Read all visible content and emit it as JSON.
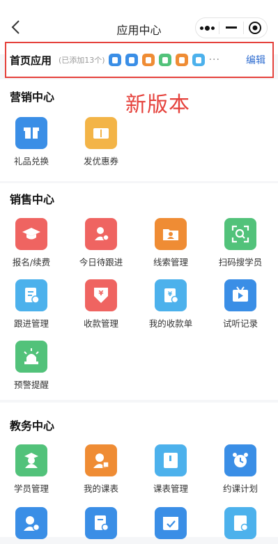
{
  "nav": {
    "title": "应用中心"
  },
  "home_apps": {
    "title": "首页应用",
    "added": "(已添加13个)",
    "more": "···",
    "edit": "编辑",
    "mini_icons": [
      {
        "icon": "student-icon",
        "color": "#3a8ee6"
      },
      {
        "icon": "doc-icon",
        "color": "#3a8ee6"
      },
      {
        "icon": "folder-icon",
        "color": "#ef8c34"
      },
      {
        "icon": "trophy-icon",
        "color": "#52c27a"
      },
      {
        "icon": "person-icon",
        "color": "#ef8c34"
      },
      {
        "icon": "book-icon",
        "color": "#4cb1ec"
      }
    ]
  },
  "annotation": "新版本",
  "marketing": {
    "title": "营销中心",
    "apps": [
      {
        "label": "礼品兑换",
        "icon": "gift-icon",
        "color": "#3a8ee6"
      },
      {
        "label": "发优惠券",
        "icon": "coupon-icon",
        "color": "#f3b447"
      }
    ]
  },
  "sales": {
    "title": "销售中心",
    "apps": [
      {
        "label": "报名/续费",
        "icon": "graduation-cap-icon",
        "color": "#ef6461"
      },
      {
        "label": "今日待跟进",
        "icon": "person-clock-icon",
        "color": "#ef6461"
      },
      {
        "label": "线索管理",
        "icon": "folder-person-icon",
        "color": "#ef8c34"
      },
      {
        "label": "扫码搜学员",
        "icon": "scan-search-icon",
        "color": "#52c27a"
      },
      {
        "label": "跟进管理",
        "icon": "doc-clock-icon",
        "color": "#4cb1ec"
      },
      {
        "label": "收款管理",
        "icon": "yen-icon",
        "color": "#ef6461"
      },
      {
        "label": "我的收款单",
        "icon": "receipt-icon",
        "color": "#4cb1ec"
      },
      {
        "label": "试听记录",
        "icon": "tv-play-icon",
        "color": "#3a8ee6"
      },
      {
        "label": "预警提醒",
        "icon": "alarm-light-icon",
        "color": "#52c27a"
      }
    ]
  },
  "academic": {
    "title": "教务中心",
    "apps": [
      {
        "label": "学员管理",
        "icon": "student-icon",
        "color": "#52c27a"
      },
      {
        "label": "我的课表",
        "icon": "person-table-icon",
        "color": "#ef8c34"
      },
      {
        "label": "课表管理",
        "icon": "book-icon",
        "color": "#4cb1ec"
      },
      {
        "label": "约课计划",
        "icon": "alarm-clock-icon",
        "color": "#3a8ee6"
      },
      {
        "label": "",
        "icon": "person-check-icon",
        "color": "#3a8ee6"
      },
      {
        "label": "",
        "icon": "doc-check-icon",
        "color": "#3a8ee6"
      },
      {
        "label": "",
        "icon": "calendar-check-icon",
        "color": "#3a8ee6"
      },
      {
        "label": "",
        "icon": "book-time-icon",
        "color": "#4cb1ec"
      }
    ]
  }
}
